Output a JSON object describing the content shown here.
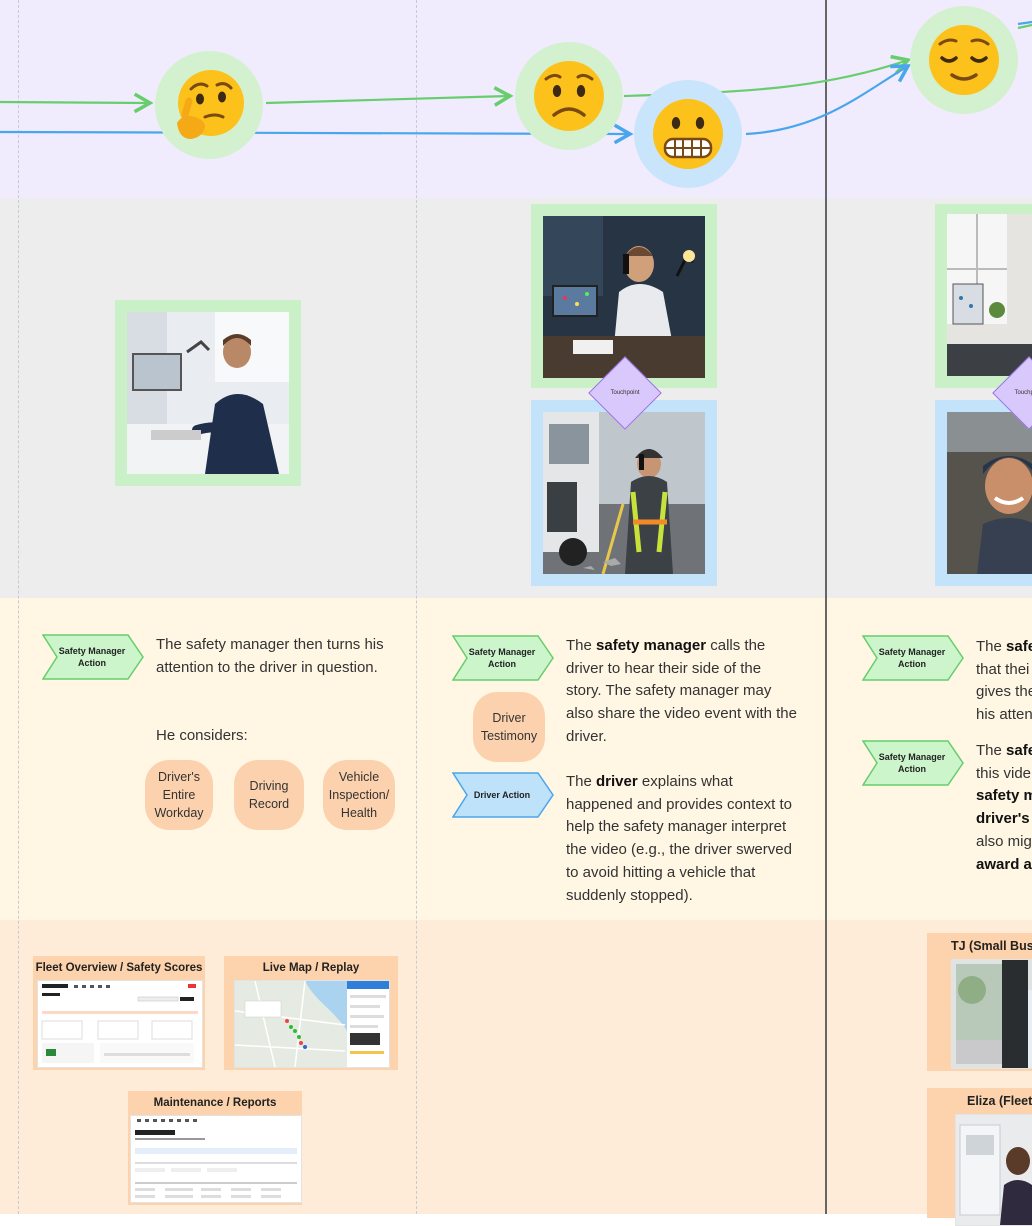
{
  "emotions": [
    {
      "name": "thinking-face",
      "ring": "#d3f1cf"
    },
    {
      "name": "worried-face",
      "ring": "#d3f1cf"
    },
    {
      "name": "grimacing-face",
      "ring": "#c9e5fb"
    },
    {
      "name": "relieved-face",
      "ring": "#d3f1cf"
    }
  ],
  "colors": {
    "green_line": "#67cd6d",
    "blue_line": "#4aa6ec",
    "green_frame": "#c9f0c7",
    "blue_frame": "#c3e3fb",
    "touchpoint": "#d9c8fb",
    "pill": "#fcd2ae",
    "chevron_green": "#cdf5cc",
    "chevron_blue": "#bfe2fb"
  },
  "touchpoint_label": "Touchpoint",
  "column1": {
    "chevron": "Safety Manager Action",
    "text_1": "The safety manager then turns his attention to the driver in question.",
    "text_2": "He considers:",
    "pills": [
      "Driver's Entire Workday",
      "Driving Record",
      "Vehicle Inspection/ Health"
    ]
  },
  "column2": {
    "chevron_1": "Safety Manager Action",
    "pill": "Driver Testimony",
    "chevron_2": "Driver Action",
    "p1_pre": "The ",
    "p1_bold": "safety manager",
    "p1_post": " calls the driver to hear their side of the story. The safety manager may also share the video event with the driver.",
    "p2_pre": "The ",
    "p2_bold": "driver",
    "p2_post": " explains what happened and provides context to help the safety manager interpret the video (e.g., the driver swerved to avoid hitting a vehicle that suddenly stopped)."
  },
  "column3": {
    "chevron_1": "Safety Manager Action",
    "chevron_2": "Safety Manager Action",
    "t1_l1": "The safe",
    "t1_l2": "that thei",
    "t1_l3": "gives the",
    "t1_l4": "his atten",
    "t2_l1": "The safe",
    "t2_l2": "this vide",
    "t2_l3": "safety m",
    "t2_l4": "driver's",
    "t2_l5": "also mig",
    "t2_l6": "award a"
  },
  "screens": [
    {
      "title": "Fleet Overview / Safety Scores"
    },
    {
      "title": "Live Map / Replay"
    },
    {
      "title": "Maintenance / Reports"
    }
  ],
  "personas": [
    {
      "name": "TJ (Small Bus"
    },
    {
      "name": "Eliza (Fleet"
    }
  ]
}
